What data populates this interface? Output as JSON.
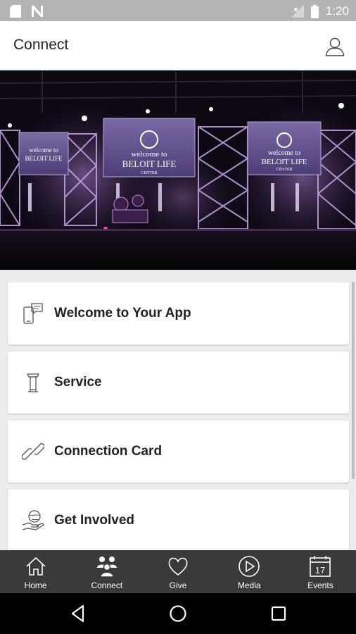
{
  "status_bar": {
    "time": "1:20",
    "icons": [
      "sd-card-icon",
      "n-notification-icon",
      "no-signal-icon",
      "battery-icon"
    ]
  },
  "header": {
    "title": "Connect",
    "profile_icon": "person-icon"
  },
  "hero": {
    "image_alt": "church stage with welcome screens",
    "screen_text": "welcome to BELOIT LIFE CENTER"
  },
  "cards": [
    {
      "label": "Welcome to Your App",
      "icon": "phone-chat-icon"
    },
    {
      "label": "Service",
      "icon": "podium-icon"
    },
    {
      "label": "Connection Card",
      "icon": "link-icon"
    },
    {
      "label": "Get Involved",
      "icon": "hand-globe-icon"
    }
  ],
  "tabs": [
    {
      "label": "Home",
      "icon": "home-icon"
    },
    {
      "label": "Connect",
      "icon": "people-icon",
      "active": true
    },
    {
      "label": "Give",
      "icon": "heart-icon"
    },
    {
      "label": "Media",
      "icon": "play-circle-icon"
    },
    {
      "label": "Events",
      "icon": "calendar-icon",
      "day": "17"
    }
  ],
  "nav": [
    "back-icon",
    "home-circle-icon",
    "recents-icon"
  ],
  "colors": {
    "status_bar": "#b3b3b3",
    "tab_bar": "#3a3a3a",
    "background": "#ececec",
    "stage_purple": "#8a5fb8"
  }
}
